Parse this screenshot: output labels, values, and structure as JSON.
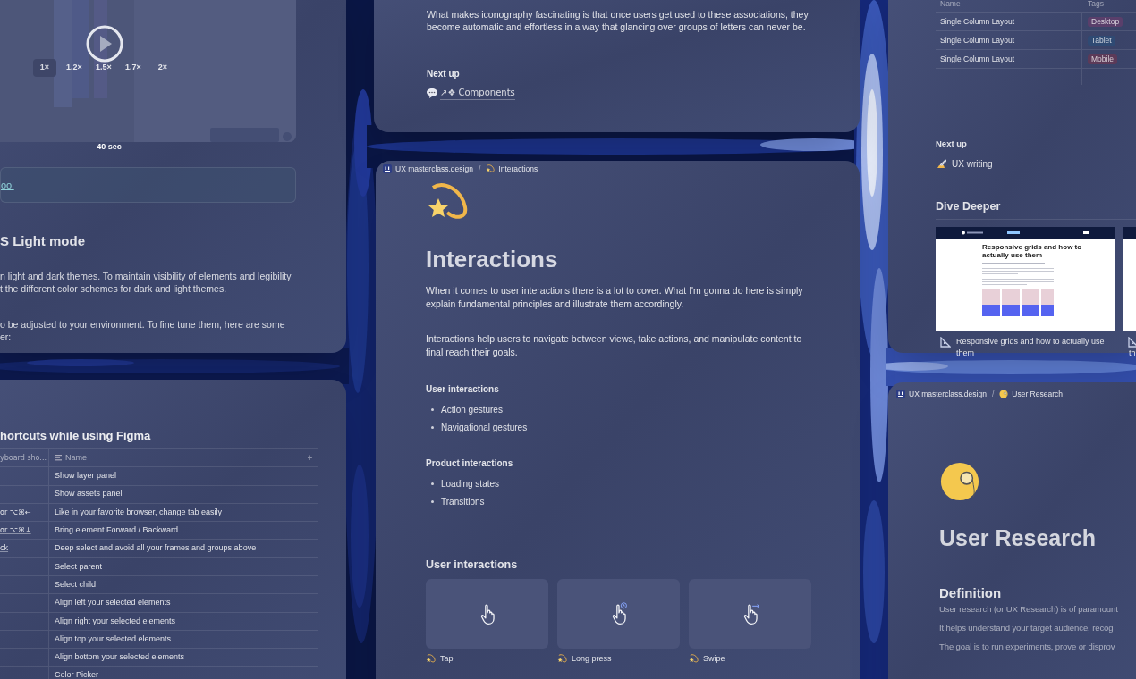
{
  "video_card": {
    "speed_options": [
      {
        "label": "1×",
        "selected": true
      },
      {
        "label": "1.2×",
        "selected": false
      },
      {
        "label": "1.5×",
        "selected": false
      },
      {
        "label": "1.7×",
        "selected": false
      },
      {
        "label": "2×",
        "selected": false
      }
    ],
    "duration": "40 sec",
    "callout_link": "ool",
    "heading": "S Light mode",
    "paragraphs": [
      [
        "n light and dark themes. To maintain visibility of elements and legibility",
        "t the different color schemes for dark and light themes."
      ],
      [
        "o be adjusted to your environment. To fine tune them, here are some",
        "er:"
      ]
    ]
  },
  "shortcuts_card": {
    "heading": "hortcuts while using Figma",
    "columns": [
      "yboard sho...",
      "Name",
      "+"
    ],
    "rows": [
      {
        "name": "Show layer panel"
      },
      {
        "name": "Show assets panel"
      },
      {
        "shortcut": "or ⌥⌘←",
        "name": "Like in your favorite browser, change tab easily"
      },
      {
        "shortcut": "or ⌥⌘↓",
        "name": "Bring element Forward / Backward"
      },
      {
        "shortcut": "ck",
        "name": "Deep select and avoid all your frames and groups above"
      },
      {
        "name": "Select parent"
      },
      {
        "name": "Select child"
      },
      {
        "name": "Align left your selected elements"
      },
      {
        "name": "Align right your selected elements"
      },
      {
        "name": "Align top your selected elements"
      },
      {
        "name": "Align bottom your selected elements"
      },
      {
        "name": "Color Picker"
      }
    ]
  },
  "iconography_card": {
    "paragraph": [
      "What makes iconography fascinating is that once users get used to these associations, they",
      "become automatic and effortless in a way that glancing over groups of letters can never be."
    ],
    "next_up_label": "Next up",
    "next_up_link": "↗❖ Components"
  },
  "interactions_page": {
    "breadcrumb": [
      "UX masterclass.design",
      "/",
      "Interactions"
    ],
    "title": "Interactions",
    "paragraphs": [
      [
        "When it comes to user interactions there is a lot to cover. What I'm gonna do here is simply",
        "explain fundamental principles and illustrate them accordingly."
      ],
      [
        "Interactions help users to navigate between views, take actions, and manipulate content to",
        "final reach their goals."
      ]
    ],
    "lists": [
      {
        "heading": "User interactions",
        "items": [
          "Action gestures",
          "Navigational gestures"
        ]
      },
      {
        "heading": "Product interactions",
        "items": [
          "Loading states",
          "Transitions"
        ]
      }
    ],
    "section_heading": "User interactions",
    "gestures": [
      {
        "kind": "tap",
        "label": "Tap"
      },
      {
        "kind": "long_press",
        "label": "Long press"
      },
      {
        "kind": "swipe",
        "label": "Swipe"
      }
    ]
  },
  "layouts_card": {
    "columns": [
      "Name",
      "Tags"
    ],
    "rows": [
      {
        "name": "Single Column Layout",
        "tag": "Desktop",
        "color": "#5a3f6b"
      },
      {
        "name": "Single Column Layout",
        "tag": "Tablet",
        "color": "#2f4a73"
      },
      {
        "name": "Single Column Layout",
        "tag": "Mobile",
        "color": "#5c3a58"
      }
    ],
    "next_up_label": "Next up",
    "next_up_link": "UX writing",
    "dive_deeper": "Dive Deeper",
    "articles": [
      {
        "thumbnail_title": "Responsive grids and how to actually use them",
        "caption": "Responsive grids and how to actually use them"
      },
      {
        "caption": "th"
      }
    ]
  },
  "user_research_page": {
    "breadcrumb": [
      "UX masterclass.design",
      "/",
      "User Research"
    ],
    "title": "User Research",
    "section_heading": "Definition",
    "lines": [
      "User research (or UX Research) is of paramount",
      "It helps understand your target audience, recog",
      "The goal is to run experiments, prove or disprov"
    ]
  }
}
